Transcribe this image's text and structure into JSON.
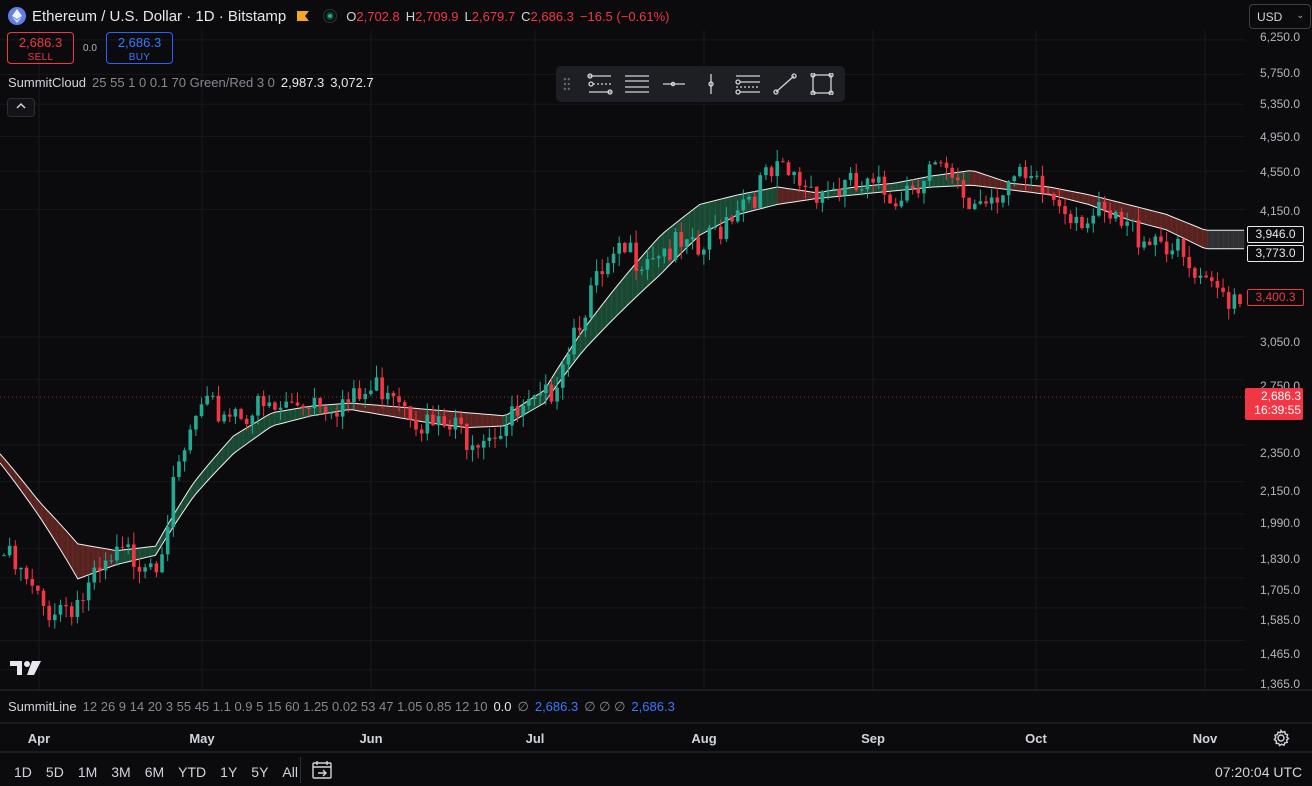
{
  "header": {
    "title": "Ethereum / U.S. Dollar · 1D · Bitstamp",
    "ohlc": [
      {
        "k": "O",
        "v": "2,702.8"
      },
      {
        "k": "H",
        "v": "2,709.9"
      },
      {
        "k": "L",
        "v": "2,679.7"
      },
      {
        "k": "C",
        "v": "2,686.3"
      }
    ],
    "change": "−16.5 (−0.61%)",
    "icons": [
      "ethereum-logo-icon",
      "flag-icon",
      "market-status-icon"
    ]
  },
  "trade": {
    "sell_price": "2,686.3",
    "sell_label": "SELL",
    "spread": "0.0",
    "buy_price": "2,686.3",
    "buy_label": "BUY"
  },
  "indicator_cloud": {
    "name": "SummitCloud",
    "params": "25 55 1 0 0.1 70 Green/Red 3 0",
    "value1": "2,987.3",
    "value2": "3,072.7"
  },
  "currency": "USD",
  "drawing_toolbar": [
    "grip-icon",
    "parallel-channel-icon",
    "horizontal-lines-icon",
    "horizontal-ray-icon",
    "vertical-line-icon",
    "fib-retracement-icon",
    "trend-line-icon",
    "rectangle-icon"
  ],
  "price_axis": [
    "6,250.0",
    "5,750.0",
    "5,350.0",
    "4,950.0",
    "4,550.0",
    "4,150.0",
    "3,050.0",
    "2,750.0",
    "2,350.0",
    "2,150.0",
    "1,990.0",
    "1,830.0",
    "1,705.0",
    "1,585.0",
    "1,465.0",
    "1,365.0"
  ],
  "price_tags": {
    "cloud_upper": "3,946.0",
    "cloud_lower": "3,773.0",
    "line_value": "3,400.3",
    "current_price": "2,686.3",
    "countdown": "16:39:55"
  },
  "indicator_line": {
    "name": "SummitLine",
    "params": "12 26 9 14 20 3 55 45 1.1 0.9 5 15 60 1.25 0.02 53 47 1.05 0.85 12 10",
    "v1": "0.0",
    "na1": "∅",
    "v2": "2,686.3",
    "na2": "∅ ∅ ∅",
    "v3": "2,686.3"
  },
  "time_axis": [
    "Apr",
    "May",
    "Jun",
    "Jul",
    "Aug",
    "Sep",
    "Oct",
    "Nov"
  ],
  "ranges": [
    "1D",
    "5D",
    "1M",
    "3M",
    "6M",
    "YTD",
    "1Y",
    "5Y",
    "All"
  ],
  "clock": "07:20:04 UTC",
  "colors": {
    "background": "#0b0b0d",
    "up": "#22ab94",
    "down": "#f23645",
    "cloud_bull": "#1f5a3e",
    "cloud_bear": "#6b2a26",
    "cloud_neutral": "#3b3b40"
  },
  "chart_data": {
    "type": "candlestick",
    "title": "Ethereum / U.S. Dollar · 1D · Bitstamp",
    "ylim": [
      1300,
      6400
    ],
    "y_scale": "log",
    "x": [
      "Mar 31",
      "Apr 7",
      "Apr 14",
      "Apr 21",
      "Apr 28",
      "May 5",
      "May 12",
      "May 19",
      "May 26",
      "Jun 2",
      "Jun 9",
      "Jun 16",
      "Jun 23",
      "Jun 30",
      "Jul 7",
      "Jul 14",
      "Jul 21",
      "Jul 28",
      "Aug 4",
      "Aug 11",
      "Aug 18",
      "Aug 25",
      "Sep 1",
      "Sep 8",
      "Sep 15",
      "Sep 22",
      "Sep 29",
      "Oct 6",
      "Oct 13",
      "Oct 20",
      "Oct 27",
      "Nov 3",
      "Nov 6"
    ],
    "close": [
      1800,
      1580,
      1620,
      1790,
      1810,
      2520,
      2570,
      2540,
      2650,
      2590,
      2750,
      2450,
      2420,
      2470,
      2590,
      3300,
      3700,
      3800,
      3700,
      4250,
      4500,
      4400,
      4350,
      4300,
      4600,
      4200,
      4450,
      4300,
      4100,
      3950,
      3900,
      3400,
      3400
    ],
    "cloud_upper": [
      2300,
      2050,
      1850,
      1820,
      1840,
      2150,
      2400,
      2540,
      2580,
      2600,
      2580,
      2560,
      2540,
      2520,
      2680,
      3100,
      3500,
      3900,
      4200,
      4300,
      4380,
      4320,
      4380,
      4420,
      4500,
      4560,
      4420,
      4380,
      4300,
      4200,
      4100,
      3946,
      3946
    ],
    "cloud_lower": [
      2250,
      1980,
      1700,
      1760,
      1800,
      2080,
      2300,
      2460,
      2520,
      2560,
      2520,
      2480,
      2450,
      2460,
      2600,
      2950,
      3250,
      3550,
      3900,
      4100,
      4200,
      4260,
      4300,
      4340,
      4380,
      4400,
      4350,
      4300,
      4200,
      4050,
      3950,
      3773,
      3773
    ],
    "ylabel": "",
    "xlabel": ""
  }
}
